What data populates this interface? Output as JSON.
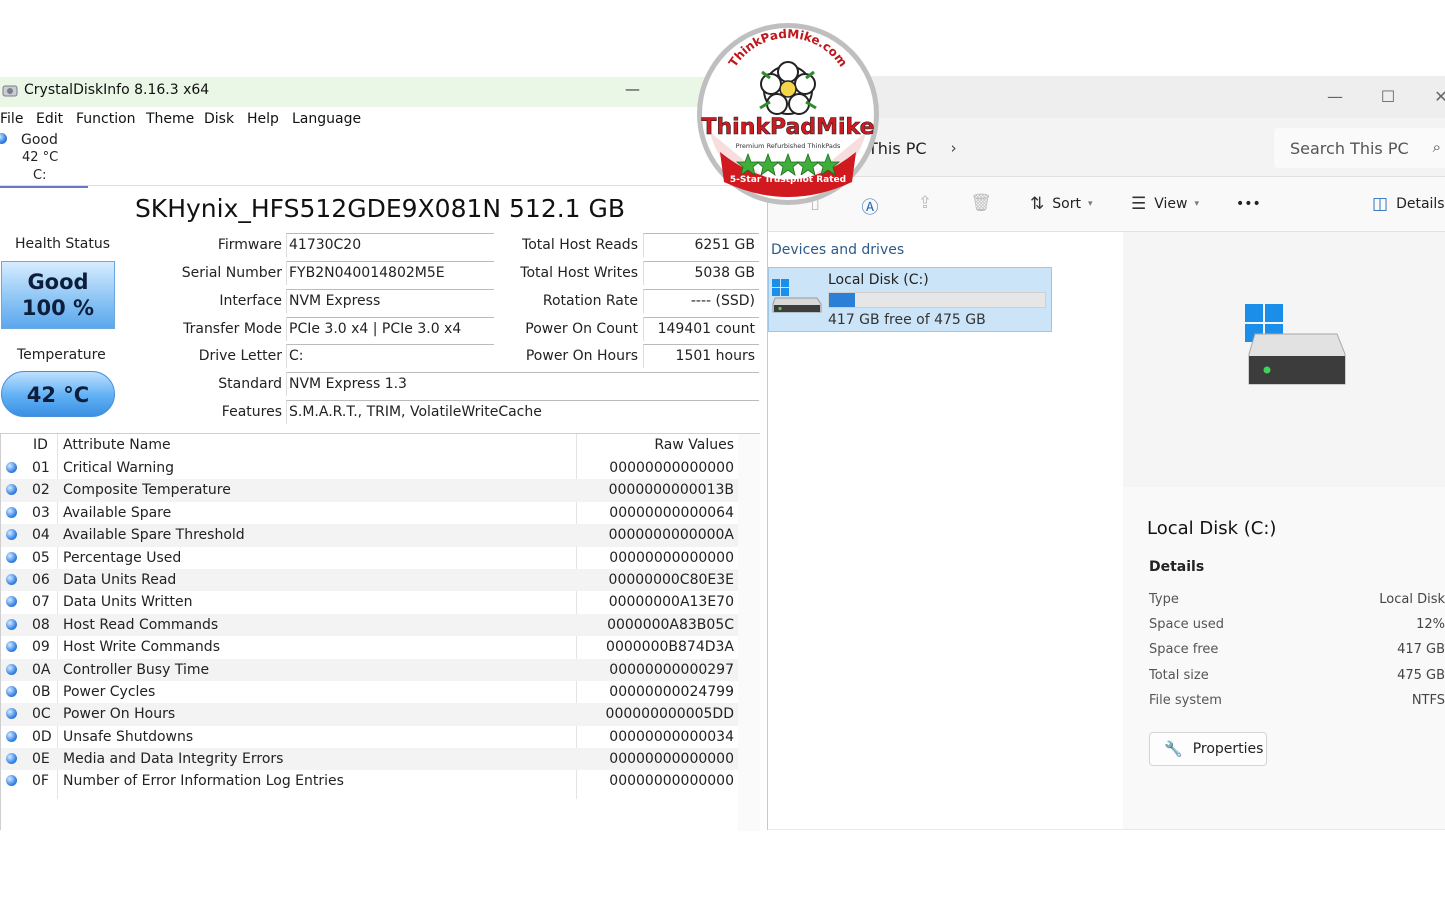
{
  "crystaldiskinfo": {
    "title": "CrystalDiskInfo 8.16.3 x64",
    "menu": [
      "File",
      "Edit",
      "Function",
      "Theme",
      "Disk",
      "Help",
      "Language"
    ],
    "disk_tab": {
      "status": "Good",
      "temp": "42 °C",
      "drive": "C:"
    },
    "model": "SKHynix_HFS512GDE9X081N 512.1 GB",
    "health": {
      "label": "Health Status",
      "status": "Good",
      "percent": "100 %",
      "color": "#8ec6f5"
    },
    "temperature": {
      "label": "Temperature",
      "value": "42 °C",
      "color": "#5fb0f4"
    },
    "fields_left": [
      {
        "label": "Firmware",
        "value": "41730C20"
      },
      {
        "label": "Serial Number",
        "value": "FYB2N040014802M5E"
      },
      {
        "label": "Interface",
        "value": "NVM Express"
      },
      {
        "label": "Transfer Mode",
        "value": "PCIe 3.0 x4 | PCIe 3.0 x4"
      },
      {
        "label": "Drive Letter",
        "value": "C:"
      }
    ],
    "fields_wide": [
      {
        "label": "Standard",
        "value": "NVM Express 1.3"
      },
      {
        "label": "Features",
        "value": "S.M.A.R.T., TRIM, VolatileWriteCache"
      }
    ],
    "fields_right": [
      {
        "label": "Total Host Reads",
        "value": "6251 GB"
      },
      {
        "label": "Total Host Writes",
        "value": "5038 GB"
      },
      {
        "label": "Rotation Rate",
        "value": "---- (SSD)"
      },
      {
        "label": "Power On Count",
        "value": "149401 count"
      },
      {
        "label": "Power On Hours",
        "value": "1501 hours"
      }
    ],
    "table": {
      "headers": {
        "id": "ID",
        "name": "Attribute Name",
        "raw": "Raw Values"
      },
      "rows": [
        {
          "id": "01",
          "name": "Critical Warning",
          "raw": "00000000000000"
        },
        {
          "id": "02",
          "name": "Composite Temperature",
          "raw": "0000000000013B"
        },
        {
          "id": "03",
          "name": "Available Spare",
          "raw": "00000000000064"
        },
        {
          "id": "04",
          "name": "Available Spare Threshold",
          "raw": "0000000000000A"
        },
        {
          "id": "05",
          "name": "Percentage Used",
          "raw": "00000000000000"
        },
        {
          "id": "06",
          "name": "Data Units Read",
          "raw": "00000000C80E3E"
        },
        {
          "id": "07",
          "name": "Data Units Written",
          "raw": "00000000A13E70"
        },
        {
          "id": "08",
          "name": "Host Read Commands",
          "raw": "0000000A83B05C"
        },
        {
          "id": "09",
          "name": "Host Write Commands",
          "raw": "0000000B874D3A"
        },
        {
          "id": "0A",
          "name": "Controller Busy Time",
          "raw": "00000000000297"
        },
        {
          "id": "0B",
          "name": "Power Cycles",
          "raw": "00000000024799"
        },
        {
          "id": "0C",
          "name": "Power On Hours",
          "raw": "000000000005DD"
        },
        {
          "id": "0D",
          "name": "Unsafe Shutdowns",
          "raw": "00000000000034"
        },
        {
          "id": "0E",
          "name": "Media and Data Integrity Errors",
          "raw": "00000000000000"
        },
        {
          "id": "0F",
          "name": "Number of Error Information Log Entries",
          "raw": "00000000000000"
        }
      ]
    }
  },
  "explorer": {
    "breadcrumb": "This PC",
    "search_placeholder": "Search This PC",
    "toolbar": {
      "sort": "Sort",
      "view": "View",
      "more": "•••",
      "details": "Details"
    },
    "section": "Devices and drives",
    "drive_tile": {
      "name": "Local Disk (C:)",
      "free_text": "417 GB free of 475 GB",
      "used_fraction": 0.12
    },
    "details": {
      "title": "Local Disk (C:)",
      "subtitle": "Details",
      "rows": [
        {
          "label": "Type",
          "value": "Local Disk"
        },
        {
          "label": "Space used",
          "value": "12%"
        },
        {
          "label": "Space free",
          "value": "417 GB"
        },
        {
          "label": "Total size",
          "value": "475 GB"
        },
        {
          "label": "File system",
          "value": "NTFS"
        }
      ],
      "properties": "Properties"
    }
  },
  "badge": {
    "top_text": "ThinkPadMike.com",
    "brand": "ThinkPadMike",
    "tagline": "Premium Refurbished ThinkPads",
    "rating": "5-Star Trustpilot Rated"
  },
  "colors": {
    "accent": "#2b7fd6",
    "tile_selected": "#cce4f7",
    "cdi_title": "#eaf6e6",
    "badge_red": "#d01a20"
  }
}
